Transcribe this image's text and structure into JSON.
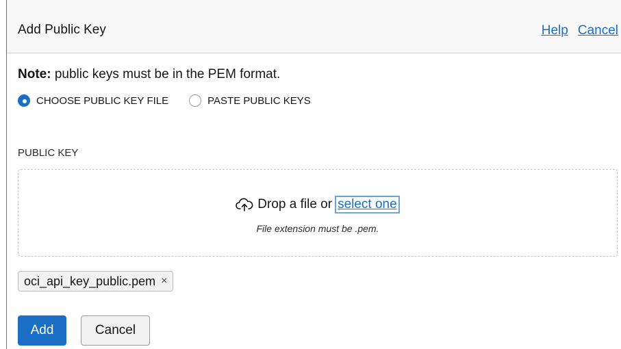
{
  "header": {
    "title": "Add Public Key",
    "help_label": "Help",
    "cancel_label": "Cancel"
  },
  "note": {
    "bold": "Note:",
    "text": " public keys must be in the PEM format."
  },
  "radio_options": [
    {
      "label": "CHOOSE PUBLIC KEY FILE",
      "checked": true
    },
    {
      "label": "PASTE PUBLIC KEYS",
      "checked": false
    }
  ],
  "public_key": {
    "label": "PUBLIC KEY",
    "drop_text": "Drop a file or",
    "select_link": "select one",
    "hint": "File extension must be .pem.",
    "file_name": "oci_api_key_public.pem",
    "remove_glyph": "×"
  },
  "footer": {
    "add_label": "Add",
    "cancel_label": "Cancel"
  },
  "colors": {
    "accent": "#1a6fc4"
  },
  "icons": {
    "upload": "cloud-upload-icon"
  }
}
